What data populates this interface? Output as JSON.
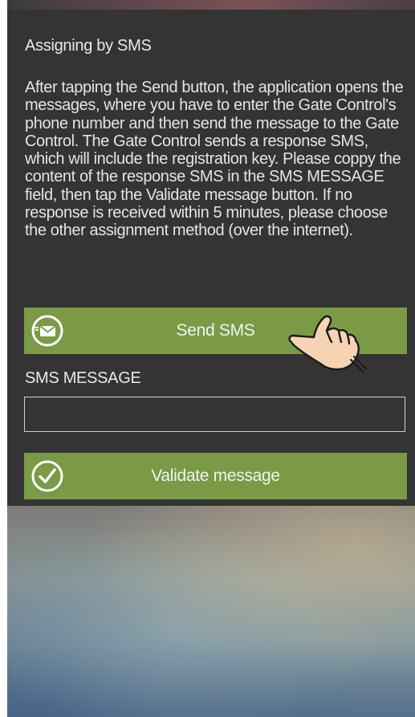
{
  "dialog": {
    "title": "Assigning by SMS",
    "description": "After tapping the Send button, the application opens the messages, where you have to enter the Gate Control's phone number and then send the message to the Gate Control. The Gate Control sends a response SMS, which will include the registration key. Please coppy the content of the response SMS in the SMS MESSAGE field, then tap the Validate message button. If no response is received within 5 minutes, please choose the other assignment method (over the internet).",
    "send_button_label": "Send SMS",
    "send_button_icon": "envelope-icon",
    "sms_field_label": "SMS MESSAGE",
    "sms_field_value": "",
    "validate_button_label": "Validate message",
    "validate_button_icon": "checkmark-icon"
  },
  "colors": {
    "panel_background": "#343434",
    "button_green": "#7a9a46",
    "text": "#e9e9e9"
  },
  "overlay": {
    "pointer": "tap-hand-icon"
  }
}
